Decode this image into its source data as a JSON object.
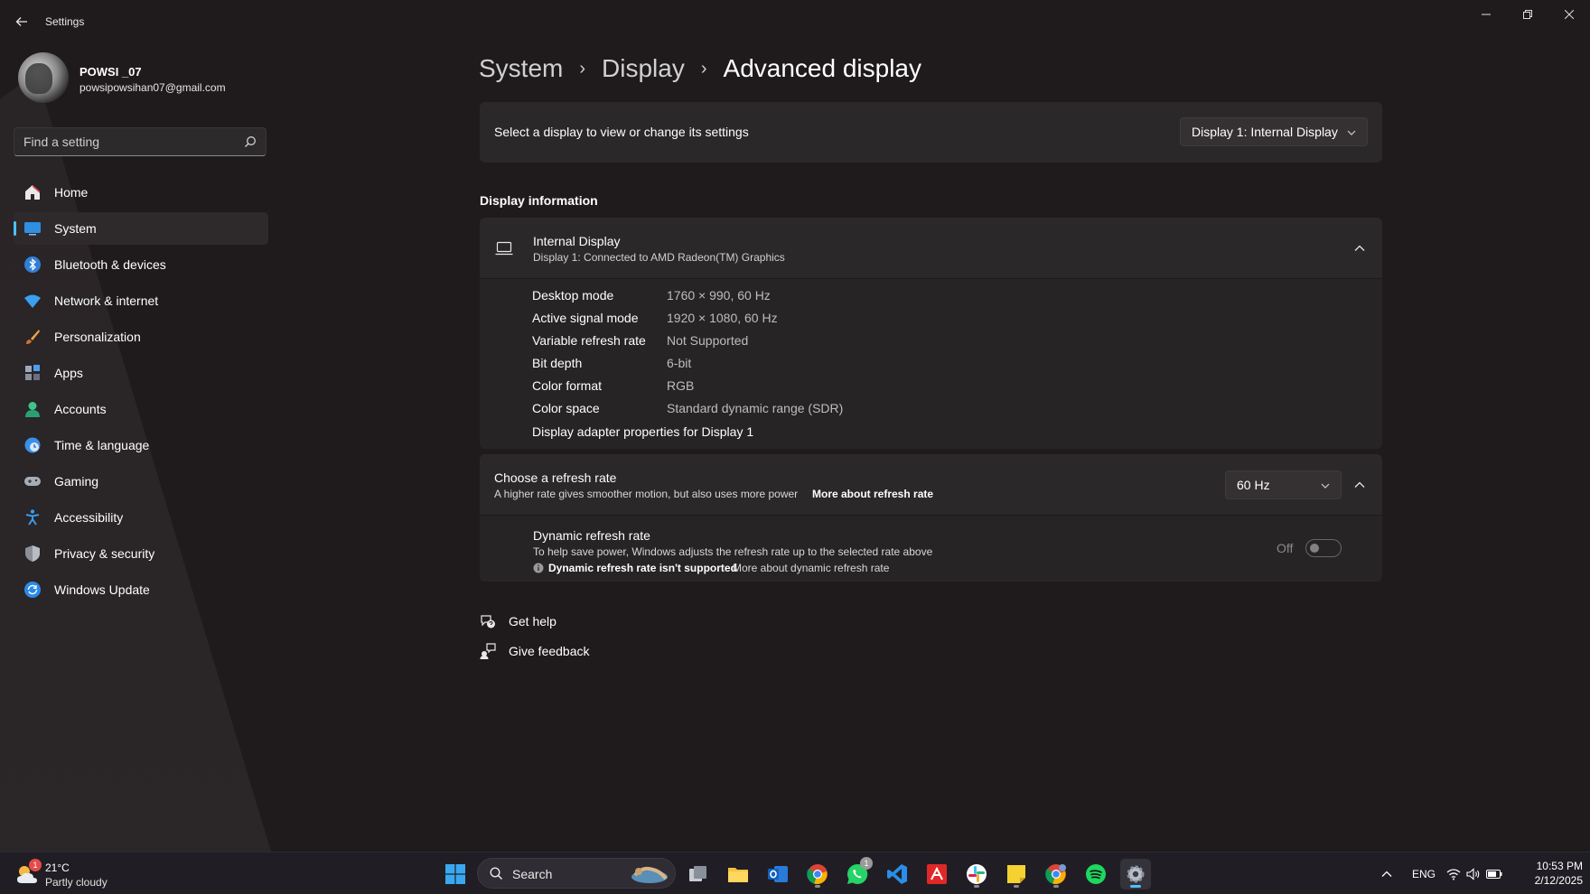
{
  "window": {
    "title": "Settings"
  },
  "profile": {
    "name": "POWSI _07",
    "email": "powsipowsihan07@gmail.com"
  },
  "search": {
    "placeholder": "Find a setting"
  },
  "nav": {
    "items": [
      {
        "label": "Home",
        "icon": "home-icon",
        "active": false
      },
      {
        "label": "System",
        "icon": "system-icon",
        "active": true
      },
      {
        "label": "Bluetooth & devices",
        "icon": "bluetooth-icon",
        "active": false
      },
      {
        "label": "Network & internet",
        "icon": "wifi-icon",
        "active": false
      },
      {
        "label": "Personalization",
        "icon": "brush-icon",
        "active": false
      },
      {
        "label": "Apps",
        "icon": "apps-icon",
        "active": false
      },
      {
        "label": "Accounts",
        "icon": "account-icon",
        "active": false
      },
      {
        "label": "Time & language",
        "icon": "globe-clock-icon",
        "active": false
      },
      {
        "label": "Gaming",
        "icon": "gamepad-icon",
        "active": false
      },
      {
        "label": "Accessibility",
        "icon": "accessibility-icon",
        "active": false
      },
      {
        "label": "Privacy & security",
        "icon": "shield-icon",
        "active": false
      },
      {
        "label": "Windows Update",
        "icon": "update-icon",
        "active": false
      }
    ]
  },
  "breadcrumb": {
    "items": [
      "System",
      "Display",
      "Advanced display"
    ]
  },
  "select_display": {
    "text": "Select a display to view or change its settings",
    "dropdown_value": "Display 1: Internal Display"
  },
  "display_info": {
    "section_title": "Display information",
    "header_title": "Internal Display",
    "header_subtitle": "Display 1: Connected to AMD Radeon(TM) Graphics",
    "rows": [
      {
        "key": "Desktop mode",
        "value": "1760 × 990, 60 Hz"
      },
      {
        "key": "Active signal mode",
        "value": "1920 × 1080, 60 Hz"
      },
      {
        "key": "Variable refresh rate",
        "value": "Not Supported"
      },
      {
        "key": "Bit depth",
        "value": "6-bit"
      },
      {
        "key": "Color format",
        "value": "RGB"
      },
      {
        "key": "Color space",
        "value": "Standard dynamic range (SDR)"
      }
    ],
    "adapter_link": "Display adapter properties for Display 1"
  },
  "refresh": {
    "title": "Choose a refresh rate",
    "description": "A higher rate gives smoother motion, but also uses more power",
    "more_link": "More about refresh rate",
    "dropdown_value": "60 Hz",
    "dynamic": {
      "title": "Dynamic refresh rate",
      "description": "To help save power, Windows adjusts the refresh rate up to the selected rate above",
      "warning": "Dynamic refresh rate isn't supported",
      "more_link": "More about dynamic refresh rate",
      "toggle_label": "Off",
      "toggle_on": false
    }
  },
  "help": {
    "get_help": "Get help",
    "give_feedback": "Give feedback"
  },
  "taskbar": {
    "weather": {
      "temp": "21°C",
      "condition": "Partly cloudy",
      "badge": "1"
    },
    "search_label": "Search",
    "apps": [
      "windows-start-icon",
      "task-view-icon",
      "file-explorer-icon",
      "outlook-icon",
      "chrome-icon",
      "whatsapp-icon",
      "vscode-icon",
      "amd-software-icon",
      "slack-icon",
      "sticky-notes-icon",
      "chrome-profile-icon",
      "spotify-icon",
      "settings-gear-icon"
    ],
    "whatsapp_badge": "1",
    "language": "ENG",
    "time": "10:53 PM",
    "date": "2/12/2025"
  },
  "colors": {
    "accent": "#4cc2ff",
    "background": "#1f1b1c",
    "card": "#2b2829"
  }
}
